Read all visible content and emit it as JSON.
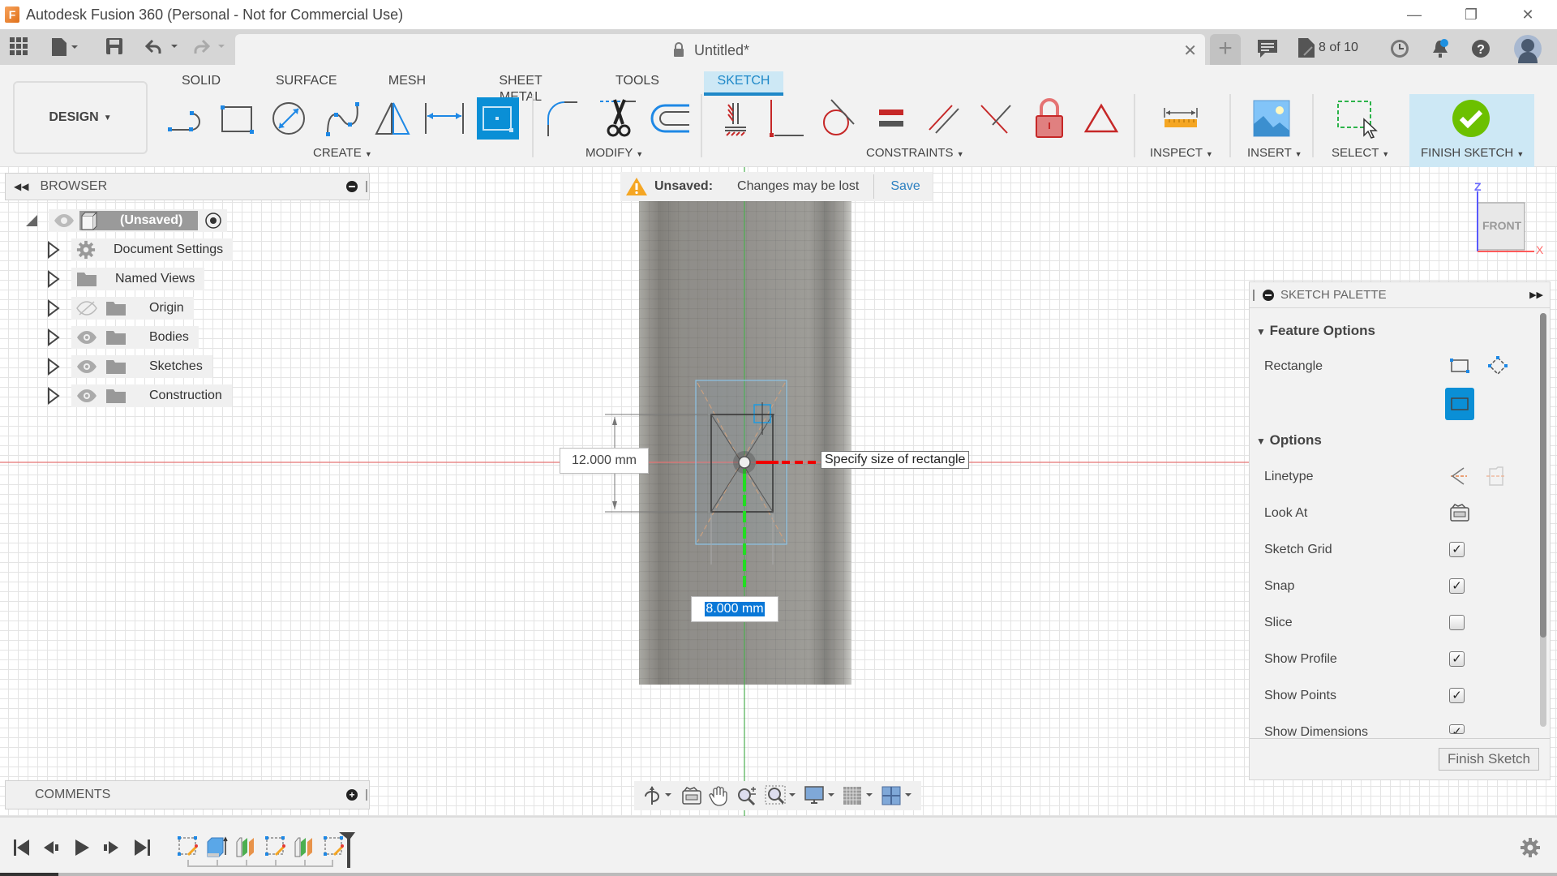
{
  "window": {
    "title": "Autodesk Fusion 360 (Personal - Not for Commercial Use)",
    "logo_letter": "F",
    "controls": {
      "minimize": "—",
      "restore": "❐",
      "close": "✕"
    }
  },
  "appbar": {
    "doc_title": "Untitled*",
    "close_tab": "✕",
    "new_tab": "+",
    "version_badge": "8 of 10",
    "icons": [
      "grid-menu-icon",
      "file-icon",
      "save-icon",
      "undo-icon",
      "redo-icon",
      "comment-icon",
      "document-versions-icon",
      "clock-icon",
      "notifications-icon",
      "help-icon",
      "profile-avatar"
    ]
  },
  "ribbon": {
    "workspace": "DESIGN",
    "tabs": [
      {
        "label": "SOLID",
        "active": false
      },
      {
        "label": "SURFACE",
        "active": false
      },
      {
        "label": "MESH",
        "active": false
      },
      {
        "label": "SHEET METAL",
        "active": false
      },
      {
        "label": "TOOLS",
        "active": false
      },
      {
        "label": "SKETCH",
        "active": true
      }
    ],
    "groups": {
      "create": "CREATE",
      "modify": "MODIFY",
      "constraints": "CONSTRAINTS",
      "inspect": "INSPECT",
      "insert": "INSERT",
      "select": "SELECT",
      "finish": "FINISH SKETCH"
    },
    "create_tools": [
      "line",
      "rectangle",
      "circle",
      "spline",
      "mirror",
      "dimension",
      "center-rectangle"
    ],
    "modify_tools": [
      "fillet",
      "trim",
      "offset"
    ],
    "constraint_tools": [
      "fix",
      "coincident",
      "tangent",
      "equal",
      "parallel",
      "perpendicular",
      "lock",
      "midpoint"
    ]
  },
  "browser": {
    "title": "BROWSER",
    "root": "(Unsaved)",
    "items": [
      {
        "label": "Document Settings",
        "icon": "gear",
        "eye": false
      },
      {
        "label": "Named Views",
        "icon": "folder",
        "eye": false
      },
      {
        "label": "Origin",
        "icon": "folder",
        "eye": "hidden"
      },
      {
        "label": "Bodies",
        "icon": "folder",
        "eye": "visible"
      },
      {
        "label": "Sketches",
        "icon": "folder",
        "eye": "visible"
      },
      {
        "label": "Construction",
        "icon": "folder",
        "eye": "visible"
      }
    ]
  },
  "warning": {
    "label": "Unsaved:",
    "message": "Changes may be lost",
    "action": "Save"
  },
  "canvas": {
    "height_dimension": "12.000 mm",
    "width_dimension_input": "8.000 mm",
    "tooltip": "Specify size of rectangle",
    "viewcube": {
      "face": "FRONT",
      "axis_z": "Z",
      "axis_x": "X"
    }
  },
  "palette": {
    "title": "SKETCH PALETTE",
    "feature_options": "Feature Options",
    "rectangle_label": "Rectangle",
    "options_header": "Options",
    "linetype_label": "Linetype",
    "lookat_label": "Look At",
    "options": [
      {
        "label": "Sketch Grid",
        "checked": true
      },
      {
        "label": "Snap",
        "checked": true
      },
      {
        "label": "Slice",
        "checked": false
      },
      {
        "label": "Show Profile",
        "checked": true
      },
      {
        "label": "Show Points",
        "checked": true
      },
      {
        "label": "Show Dimensions",
        "checked": true
      }
    ],
    "finish_button": "Finish Sketch"
  },
  "comments": {
    "title": "COMMENTS"
  },
  "timeline": {
    "features": [
      "sketch",
      "extrude",
      "plane",
      "sketch",
      "plane",
      "sketch"
    ]
  }
}
